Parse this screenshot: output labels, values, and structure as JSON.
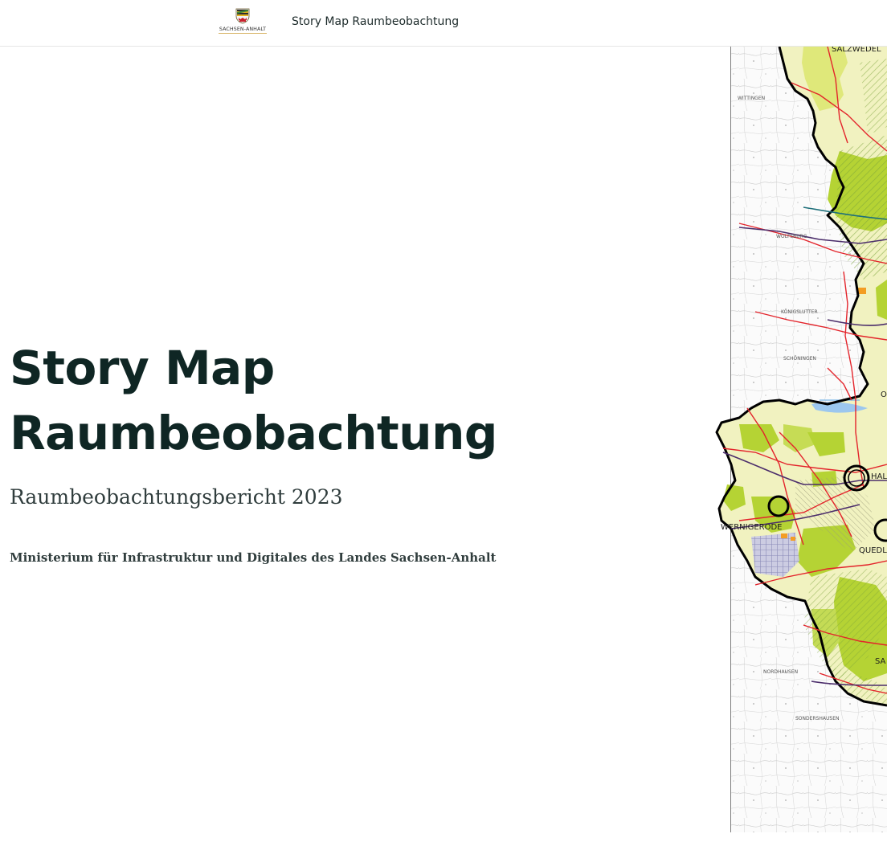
{
  "header": {
    "logo_text": "SACHSEN-ANHALT",
    "title": "Story Map Raumbeobachtung"
  },
  "hero": {
    "title_line1": "Story Map",
    "title_line2": "Raumbeobachtung",
    "subtitle": "Raumbeobachtungsbericht 2023",
    "byline": "Ministerium für Infrastruktur und Digitales des Landes Sachsen-Anhalt"
  },
  "map": {
    "labels": {
      "salzwedel": "SALZWEDEL",
      "wolfsburg": "WOLFSBURG",
      "wernigerode": "WERNIGERODE",
      "halberstadt": "HAL",
      "quedlinburg": "QUEDL",
      "sangerhausen": "SA",
      "nordhausen": "NORDHAUSEN",
      "wittingen": "WITTINGEN",
      "schoeningen": "SCHÖNINGEN",
      "koenigslutter": "KÖNIGSLUTTER",
      "sondershausen": "SONDERSHAUSEN",
      "oschersleben": "O"
    },
    "colors": {
      "boundary": "#000000",
      "lime": "#b5d334",
      "pale_yellow": "#eef0a8",
      "roads": "#e3242b",
      "rail": "#4b2d6b",
      "water": "#7ab6e8",
      "reserve": "#c8c8e6"
    }
  }
}
